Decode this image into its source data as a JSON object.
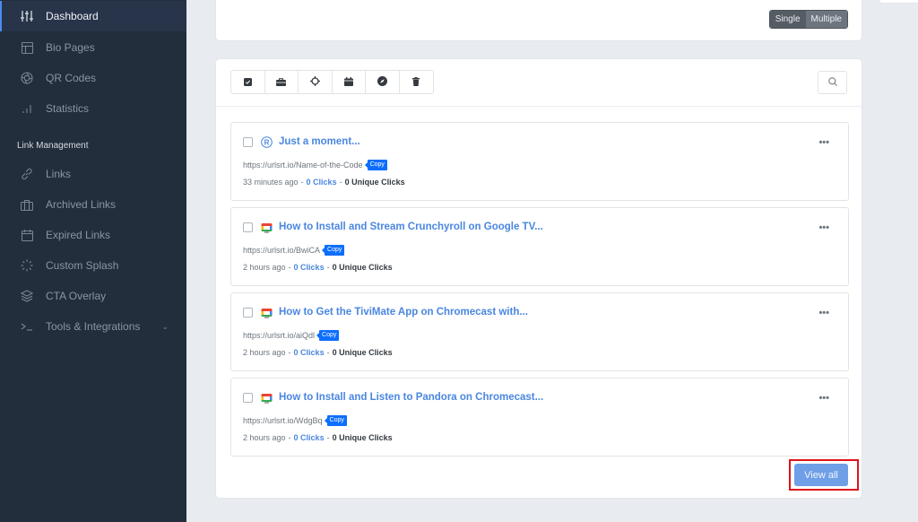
{
  "sidebar": {
    "items": [
      {
        "label": "Dashboard",
        "icon": "sliders-icon",
        "active": true
      },
      {
        "label": "Bio Pages",
        "icon": "layout-icon"
      },
      {
        "label": "QR Codes",
        "icon": "aperture-icon"
      },
      {
        "label": "Statistics",
        "icon": "bar-chart-icon"
      }
    ],
    "section_label": "Link Management",
    "link_items": [
      {
        "label": "Links",
        "icon": "link-icon"
      },
      {
        "label": "Archived Links",
        "icon": "briefcase-icon"
      },
      {
        "label": "Expired Links",
        "icon": "calendar-icon"
      },
      {
        "label": "Custom Splash",
        "icon": "loader-icon"
      },
      {
        "label": "CTA Overlay",
        "icon": "layers-icon"
      },
      {
        "label": "Tools & Integrations",
        "icon": "terminal-icon",
        "chevron": "chevron-down-icon"
      }
    ]
  },
  "top_card": {
    "segmented": {
      "single": "Single",
      "multiple": "Multiple"
    }
  },
  "toolbar": {
    "buttons": [
      "select-all-icon",
      "archive-icon",
      "target-icon",
      "calendar-icon",
      "compass-icon",
      "trash-icon"
    ]
  },
  "links": [
    {
      "title": "Just a moment...",
      "favicon": "r-logo-icon",
      "url": "https://urlsrt.io/Name-of-the-Code",
      "copy_label": "Copy",
      "time": "33 minutes ago",
      "clicks": "0 Clicks",
      "unique": "0 Unique Clicks"
    },
    {
      "title": "How to Install and Stream Crunchyroll on Google TV...",
      "favicon": "google-tv-icon",
      "url": "https://urlsrt.io/BwiCA",
      "copy_label": "Copy",
      "time": "2 hours ago",
      "clicks": "0 Clicks",
      "unique": "0 Unique Clicks"
    },
    {
      "title": "How to Get the TiviMate App on Chromecast with...",
      "favicon": "google-tv-icon",
      "url": "https://urlsrt.io/aiQdl",
      "copy_label": "Copy",
      "time": "2 hours ago",
      "clicks": "0 Clicks",
      "unique": "0 Unique Clicks"
    },
    {
      "title": "How to Install and Listen to Pandora on Chromecast...",
      "favicon": "google-tv-icon",
      "url": "https://urlsrt.io/WdgBq",
      "copy_label": "Copy",
      "time": "2 hours ago",
      "clicks": "0 Clicks",
      "unique": "0 Unique Clicks"
    }
  ],
  "separator": "-",
  "view_all_label": "View all",
  "colors": {
    "sidebar_bg": "#232e3d",
    "accent": "#4a86e0",
    "copy_badge": "#0d6efd",
    "highlight_box": "#e0131a"
  }
}
